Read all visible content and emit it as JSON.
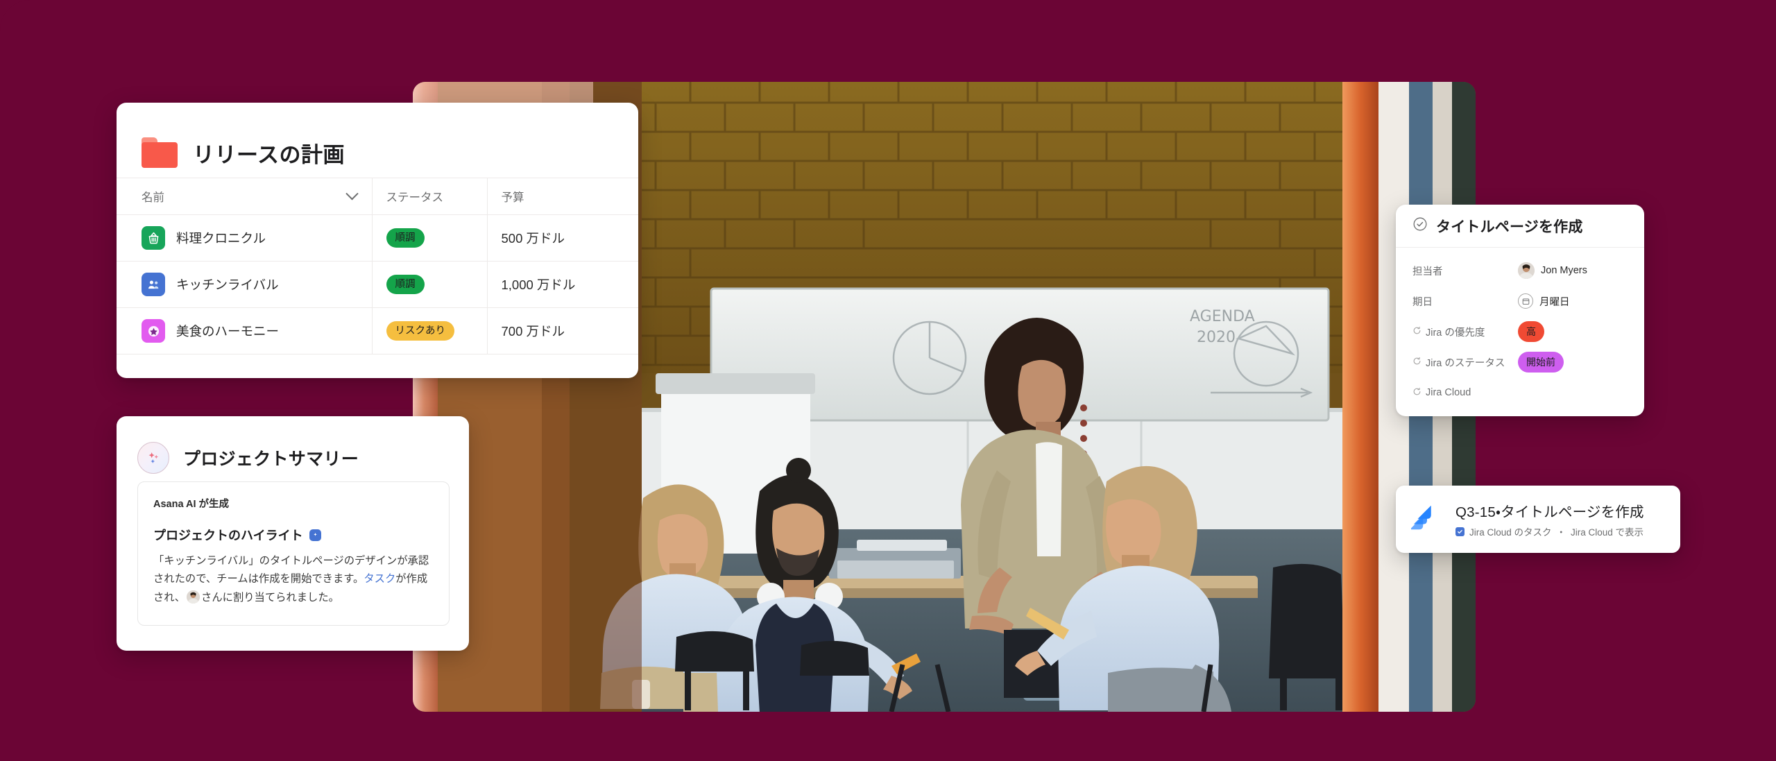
{
  "theme": {
    "background": "#6b0535",
    "card_bg": "#ffffff",
    "accent_blue": "#4573d2",
    "folder_coral": "#f8594a",
    "status_green": "#14a44a",
    "status_yellow": "#f5be3f",
    "priority_red": "#f04a33",
    "jira_status_magenta": "#ce5eef"
  },
  "release_card": {
    "icon": "folder-icon",
    "title": "リリースの計画",
    "columns": [
      {
        "label": "名前",
        "sort_icon": "chevron-down-icon"
      },
      {
        "label": "ステータス"
      },
      {
        "label": "予算"
      }
    ],
    "rows": [
      {
        "icon": "basket-icon",
        "icon_color": "#17a55a",
        "name": "料理クロニクル",
        "status": "順調",
        "status_color": "#14a44a",
        "budget": "500 万ドル"
      },
      {
        "icon": "people-icon",
        "icon_color": "#4573d2",
        "name": "キッチンライバル",
        "status": "順調",
        "status_color": "#14a44a",
        "budget": "1,000 万ドル"
      },
      {
        "icon": "star-icon",
        "icon_color": "#e25bef",
        "name": "美食のハーモニー",
        "status": "リスクあり",
        "status_color": "#f5be3f",
        "budget": "700 万ドル"
      }
    ]
  },
  "summary_card": {
    "icon": "ai-sparkle-icon",
    "title": "プロジェクトサマリー",
    "generated_by": "Asana AI が生成",
    "highlight_heading": "プロジェクトのハイライト",
    "highlight_badge_icon": "sparkle-badge-icon",
    "body_part1": "「キッチンライバル」のタイトルページのデザインが承認されたので、チームは作成を開始できます。",
    "body_link": "タスク",
    "body_part2": "が作成され、",
    "body_part3": "さんに割り当てられました。"
  },
  "task_card": {
    "status_icon": "check-circle-icon",
    "title": "タイトルページを作成",
    "fields": [
      {
        "label": "担当者",
        "label_icon": "",
        "value_type": "avatar",
        "value": "Jon Myers"
      },
      {
        "label": "期日",
        "label_icon": "",
        "value_type": "calendar",
        "value": "月曜日"
      },
      {
        "label": "Jira の優先度",
        "label_icon": "sync-icon",
        "value_type": "pill",
        "value": "高",
        "pill_color": "#f04a33"
      },
      {
        "label": "Jira のステータス",
        "label_icon": "sync-icon",
        "value_type": "pill",
        "value": "開始前",
        "pill_color": "#ce5eef"
      },
      {
        "label": "Jira Cloud",
        "label_icon": "sync-icon",
        "value_type": "none",
        "value": ""
      }
    ]
  },
  "jira_toast": {
    "icon": "jira-logo-icon",
    "title": "Q3-15・タイトルページを作成",
    "checkbox_icon": "checkbox-checked-icon",
    "subtitle_a": "Jira Cloud のタスク",
    "separator": "・",
    "subtitle_b": "Jira Cloud で表示"
  },
  "photo": {
    "alt": "ブレインストーミングをするチームの写真"
  }
}
